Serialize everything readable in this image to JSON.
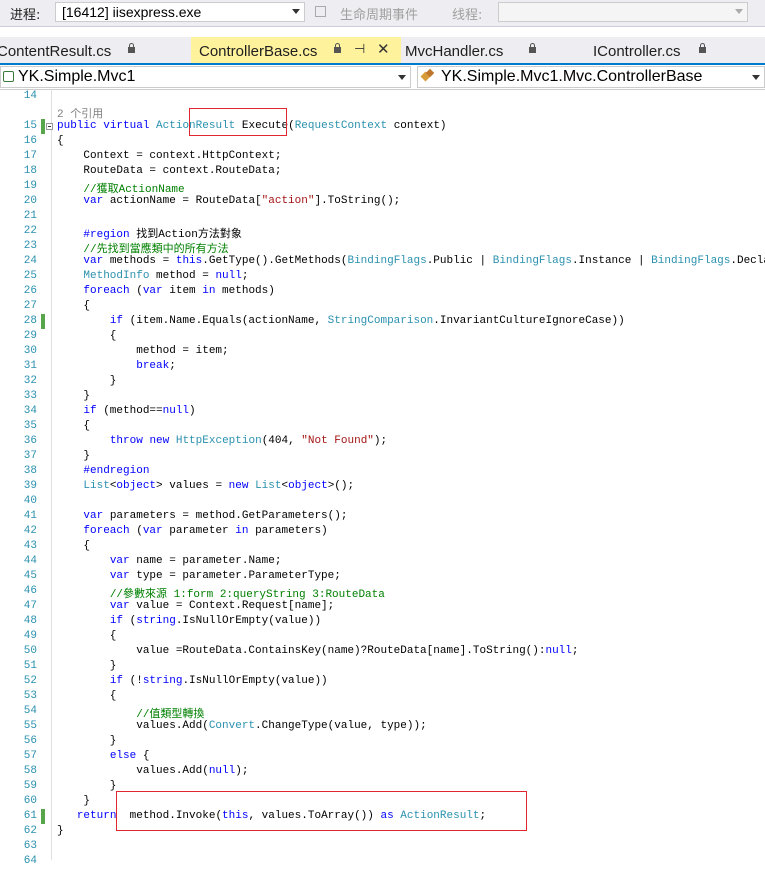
{
  "toolbar": {
    "process_label": "进程:",
    "process_value": "[16412] iisexpress.exe",
    "lifecycle_label": "生命周期事件",
    "thread_label": "线程:"
  },
  "tabs": [
    {
      "label": "ContentResult.cs",
      "pinned": true
    },
    {
      "label": "ControllerBase.cs",
      "active": true,
      "pinned": true
    },
    {
      "label": "MvcHandler.cs",
      "pinned": true
    },
    {
      "label": "IController.cs",
      "pinned": true
    }
  ],
  "nav": {
    "project": "YK.Simple.Mvc1",
    "member": "YK.Simple.Mvc1.Mvc.ControllerBase"
  },
  "colors": {
    "keyword": "#0000ff",
    "type": "#2b91af",
    "comment": "#008000",
    "string": "#a31515",
    "highlight_box": "#e0262e",
    "active_tab": "#fff29d"
  },
  "code_lines": [
    {
      "n": "14",
      "html": ""
    },
    {
      "n": "",
      "html": "            <span class='cl'>2 个引用</span>"
    },
    {
      "n": "15",
      "html": "            <span class='kw'>public</span> <span class='kw'>virtual</span> <span class='ty'>ActionResult</span> Execute(<span class='ty'>RequestContext</span> context)"
    },
    {
      "n": "16",
      "html": "            {"
    },
    {
      "n": "17",
      "html": "                Context = context.HttpContext;"
    },
    {
      "n": "18",
      "html": "                RouteData = context.RouteData;"
    },
    {
      "n": "19",
      "html": "                <span class='cm'>//獲取ActionName</span>"
    },
    {
      "n": "20",
      "html": "                <span class='kw'>var</span> actionName = RouteData[<span class='st'>\"action\"</span>].ToString();"
    },
    {
      "n": "21",
      "html": ""
    },
    {
      "n": "22",
      "html": "                <span class='kw'>#region</span> 找到Action方法對象"
    },
    {
      "n": "23",
      "html": "                <span class='cm'>//先找到當應類中的所有方法</span>"
    },
    {
      "n": "24",
      "html": "                <span class='kw'>var</span> methods = <span class='kw'>this</span>.GetType().GetMethods(<span class='ty'>BindingFlags</span>.Public | <span class='ty'>BindingFlags</span>.Instance | <span class='ty'>BindingFlags</span>.Declared"
    },
    {
      "n": "25",
      "html": "                <span class='ty'>MethodInfo</span> method = <span class='kw'>null</span>;"
    },
    {
      "n": "26",
      "html": "                <span class='kw'>foreach</span> (<span class='kw'>var</span> item <span class='kw'>in</span> methods)"
    },
    {
      "n": "27",
      "html": "                {"
    },
    {
      "n": "28",
      "html": "                    <span class='kw'>if</span> (item.Name.Equals(actionName, <span class='ty'>StringComparison</span>.InvariantCultureIgnoreCase))"
    },
    {
      "n": "29",
      "html": "                    {"
    },
    {
      "n": "30",
      "html": "                        method = item;"
    },
    {
      "n": "31",
      "html": "                        <span class='kw'>break</span>;"
    },
    {
      "n": "32",
      "html": "                    }"
    },
    {
      "n": "33",
      "html": "                }"
    },
    {
      "n": "34",
      "html": "                <span class='kw'>if</span> (method==<span class='kw'>null</span>)"
    },
    {
      "n": "35",
      "html": "                {"
    },
    {
      "n": "36",
      "html": "                    <span class='kw'>throw</span> <span class='kw'>new</span> <span class='ty'>HttpException</span>(404, <span class='st'>\"Not Found\"</span>);"
    },
    {
      "n": "37",
      "html": "                }"
    },
    {
      "n": "38",
      "html": "                <span class='kw'>#endregion</span>"
    },
    {
      "n": "39",
      "html": "                <span class='ty'>List</span>&lt;<span class='kw'>object</span>&gt; values = <span class='kw'>new</span> <span class='ty'>List</span>&lt;<span class='kw'>object</span>&gt;();"
    },
    {
      "n": "40",
      "html": ""
    },
    {
      "n": "41",
      "html": "                <span class='kw'>var</span> parameters = method.GetParameters();"
    },
    {
      "n": "42",
      "html": "                <span class='kw'>foreach</span> (<span class='kw'>var</span> parameter <span class='kw'>in</span> parameters)"
    },
    {
      "n": "43",
      "html": "                {"
    },
    {
      "n": "44",
      "html": "                    <span class='kw'>var</span> name = parameter.Name;"
    },
    {
      "n": "45",
      "html": "                    <span class='kw'>var</span> type = parameter.ParameterType;"
    },
    {
      "n": "46",
      "html": "                    <span class='cm'>//參數來源 1:form 2:queryString 3:RouteData</span>"
    },
    {
      "n": "47",
      "html": "                    <span class='kw'>var</span> value = Context.Request[name];"
    },
    {
      "n": "48",
      "html": "                    <span class='kw'>if</span> (<span class='kw'>string</span>.IsNullOrEmpty(value))"
    },
    {
      "n": "49",
      "html": "                    {"
    },
    {
      "n": "50",
      "html": "                        value =RouteData.ContainsKey(name)?RouteData[name].ToString():<span class='kw'>null</span>;"
    },
    {
      "n": "51",
      "html": "                    }"
    },
    {
      "n": "52",
      "html": "                    <span class='kw'>if</span> (!<span class='kw'>string</span>.IsNullOrEmpty(value))"
    },
    {
      "n": "53",
      "html": "                    {"
    },
    {
      "n": "54",
      "html": "                        <span class='cm'>//值類型轉換</span>"
    },
    {
      "n": "55",
      "html": "                        values.Add(<span class='ty'>Convert</span>.ChangeType(value, type));"
    },
    {
      "n": "56",
      "html": "                    }"
    },
    {
      "n": "57",
      "html": "                    <span class='kw'>else</span> {"
    },
    {
      "n": "58",
      "html": "                        values.Add(<span class='kw'>null</span>);"
    },
    {
      "n": "59",
      "html": "                    }"
    },
    {
      "n": "60",
      "html": "                }"
    },
    {
      "n": "61",
      "html": "               <span class='kw'>return</span>  method.Invoke(<span class='kw'>this</span>, values.ToArray()) <span class='kw'>as</span> <span class='ty'>ActionResult</span>;"
    },
    {
      "n": "62",
      "html": "            }"
    },
    {
      "n": "63",
      "html": ""
    },
    {
      "n": "64",
      "html": ""
    }
  ]
}
